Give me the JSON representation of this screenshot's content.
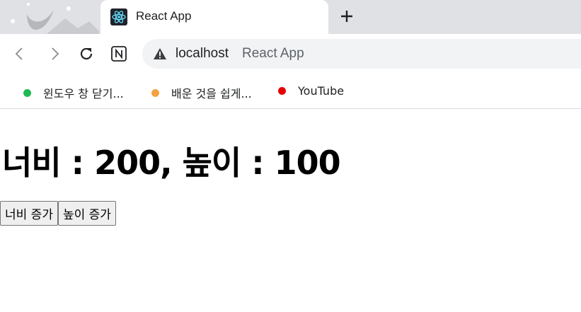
{
  "tab": {
    "title": "React App"
  },
  "address_bar": {
    "host": "localhost",
    "page_title": "React App"
  },
  "bookmarks": [
    {
      "label": "윈도우 창 닫기...",
      "color": "#1db954"
    },
    {
      "label": "배운 것을 쉽게...",
      "color": "#f4a340"
    },
    {
      "label": "YouTube",
      "color": "#e60000"
    }
  ],
  "page": {
    "heading": "너비 : 200, 높이 : 100",
    "buttons": {
      "width": "너비 증가",
      "height": "높이 증가"
    }
  },
  "icons": {
    "favicon": "react-atom-icon",
    "new_tab": "plus-icon",
    "back": "arrow-left-icon",
    "forward": "arrow-right-icon",
    "reload": "reload-icon",
    "notion": "notion-icon",
    "security": "warning-triangle-icon"
  }
}
